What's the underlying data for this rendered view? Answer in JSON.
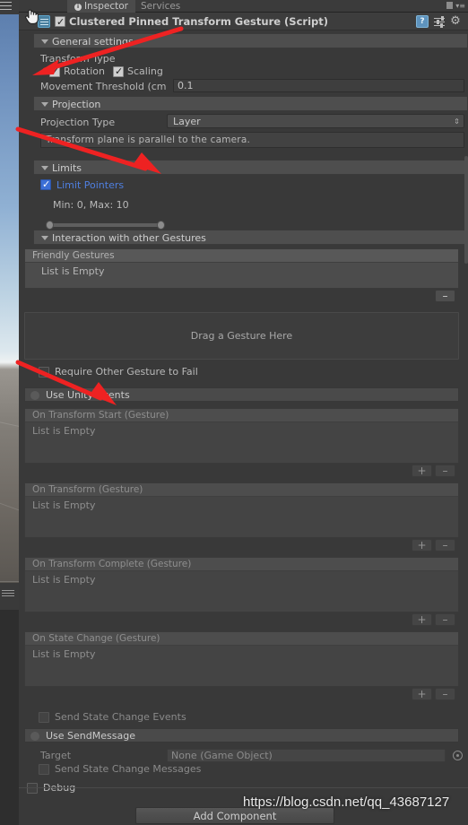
{
  "window": {
    "tabs": [
      {
        "label": "Inspector",
        "active": true,
        "icon": "info-circle-icon"
      },
      {
        "label": "Services",
        "active": false
      }
    ],
    "hamburger_icon": "hamburger-menu-icon",
    "lock_icon": "lock-icon",
    "menu_icon": "overflow-menu-icon"
  },
  "component": {
    "title": "Clustered Pinned Transform Gesture (Script)",
    "enabled": true,
    "foldout_expanded": true,
    "script_icon": "unity-script-icon",
    "header_icons": [
      {
        "name": "help-icon",
        "glyph": "?"
      },
      {
        "name": "preset-icon",
        "glyph": ""
      },
      {
        "name": "gear-icon",
        "glyph": "⚙"
      }
    ]
  },
  "sections": {
    "general": {
      "title": "General settings",
      "transform_type_label": "Transform Type",
      "rotation": {
        "label": "Rotation",
        "checked": true
      },
      "scaling": {
        "label": "Scaling",
        "checked": true
      },
      "movement_threshold": {
        "label": "Movement Threshold (cm",
        "value": "0.1"
      }
    },
    "projection": {
      "title": "Projection",
      "type_label": "Projection Type",
      "type_value": "Layer",
      "help_text": "Transform plane is parallel to the camera."
    },
    "limits": {
      "title": "Limits",
      "limit_pointers": {
        "label": "Limit Pointers",
        "checked": true
      },
      "range_label": "Min: 0, Max: 10",
      "min": 0,
      "max": 10
    },
    "interaction": {
      "title": "Interaction with other Gestures",
      "friendly_gestures": {
        "header": "Friendly Gestures",
        "empty_text": "List is Empty",
        "remove_label": "–"
      },
      "dropzone_text": "Drag a Gesture Here",
      "require_fail": {
        "label": "Require Other Gesture to Fail",
        "checked": false
      }
    },
    "unity_events": {
      "toggle_label": "Use Unity Events",
      "toggle_checked": false,
      "lists": [
        {
          "header": "On Transform Start (Gesture)",
          "empty_text": "List is Empty",
          "add_label": "+",
          "remove_label": "–"
        },
        {
          "header": "On Transform (Gesture)",
          "empty_text": "List is Empty",
          "add_label": "+",
          "remove_label": "–"
        },
        {
          "header": "On Transform Complete (Gesture)",
          "empty_text": "List is Empty",
          "add_label": "+",
          "remove_label": "–"
        },
        {
          "header": "On State Change (Gesture)",
          "empty_text": "List is Empty",
          "add_label": "+",
          "remove_label": "–"
        }
      ],
      "send_state_change_events": {
        "label": "Send State Change Events",
        "checked": false
      }
    },
    "send_message": {
      "toggle_label": "Use SendMessage",
      "toggle_checked": false,
      "target": {
        "label": "Target",
        "value": "None (Game Object)",
        "picker_icon": "object-picker-icon"
      },
      "send_state_change_messages": {
        "label": "Send State Change Messages",
        "checked": false
      }
    },
    "debug": {
      "label": "Debug",
      "checked": false
    }
  },
  "footer": {
    "add_component_label": "Add Component"
  },
  "watermark": "https://blog.csdn.net/qq_43687127",
  "annotations": {
    "arrow_color": "#ee2222",
    "arrows": 3
  },
  "colors": {
    "panel_bg": "#393939",
    "section_header": "#4e4e4e",
    "accent_blue": "#4f7fe0",
    "checkbox_blue": "#3c6fd6",
    "text": "#b9b9b9"
  }
}
